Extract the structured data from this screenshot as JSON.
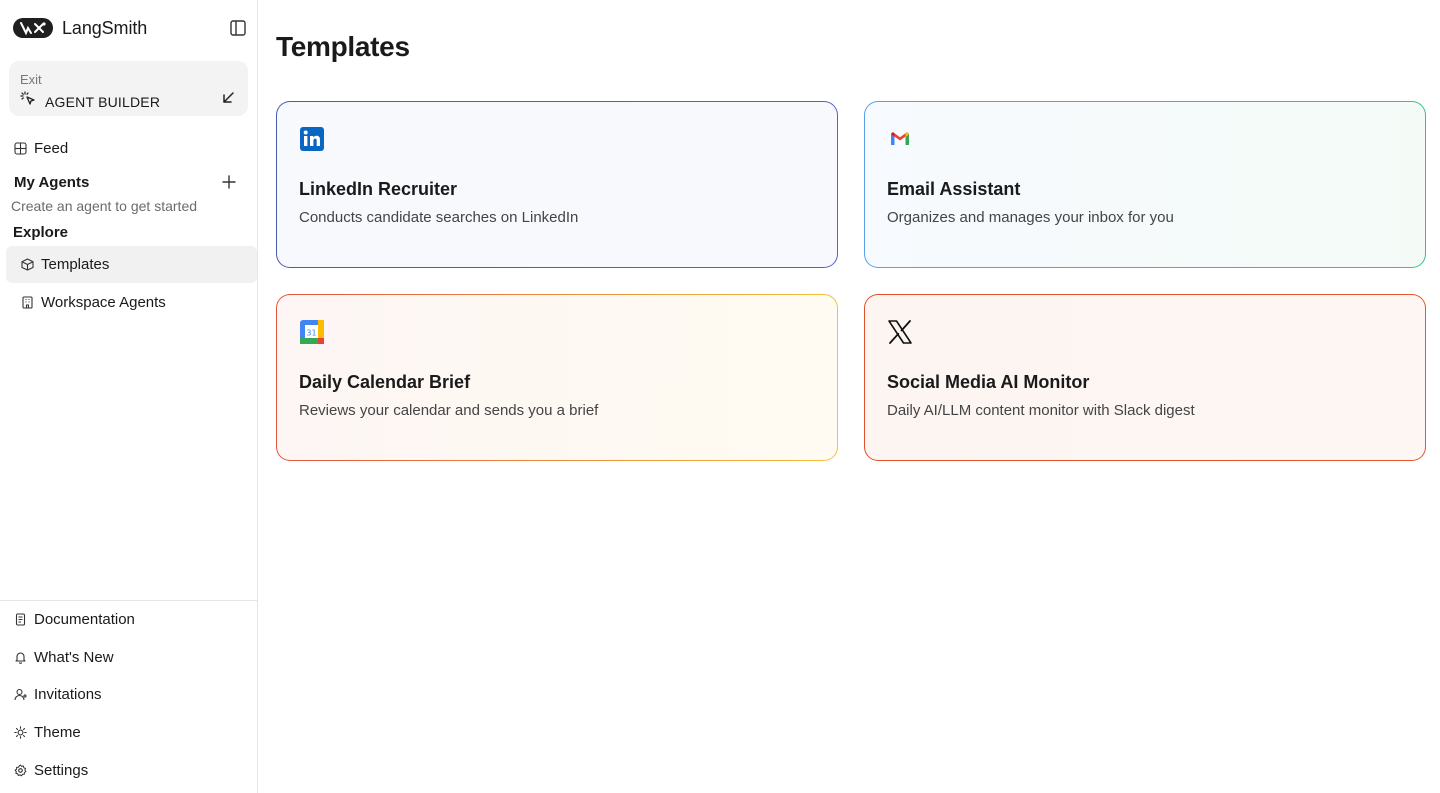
{
  "app": {
    "name": "LangSmith"
  },
  "exit_card": {
    "label": "Exit",
    "mode": "AGENT BUILDER"
  },
  "nav": {
    "feed": "Feed",
    "my_agents": "My Agents",
    "my_agents_hint": "Create an agent to get started",
    "explore": "Explore",
    "templates": "Templates",
    "workspace_agents": "Workspace Agents"
  },
  "footer_nav": {
    "documentation": "Documentation",
    "whats_new": "What's New",
    "invitations": "Invitations",
    "theme": "Theme",
    "settings": "Settings"
  },
  "page": {
    "title": "Templates"
  },
  "templates": [
    {
      "title": "LinkedIn Recruiter",
      "description": "Conducts candidate searches on LinkedIn",
      "icon": "linkedin-icon"
    },
    {
      "title": "Email Assistant",
      "description": "Organizes and manages your inbox for you",
      "icon": "gmail-icon"
    },
    {
      "title": "Daily Calendar Brief",
      "description": "Reviews your calendar and sends you a brief",
      "icon": "google-calendar-icon",
      "icon_text": "31"
    },
    {
      "title": "Social Media AI Monitor",
      "description": "Daily AI/LLM content monitor with Slack digest",
      "icon": "x-icon"
    }
  ],
  "colors": {
    "linkedin": "#0a66c2",
    "active_bg": "#f1f1f1"
  }
}
